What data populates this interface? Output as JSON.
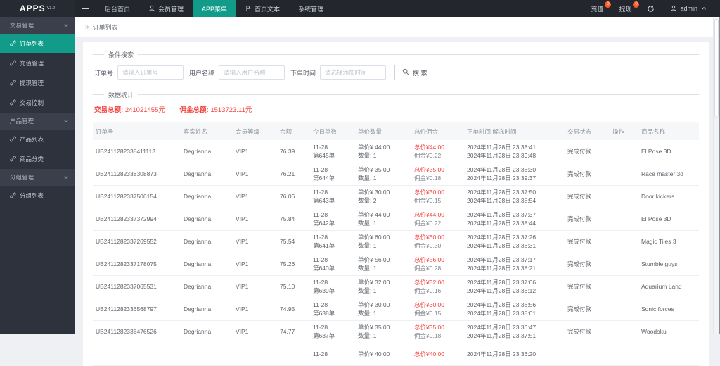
{
  "colors": {
    "accent": "#109C88",
    "red": "#F5413D",
    "badge": "#FF5A22",
    "topbar": "#23262D",
    "sidebar": "#2E323C"
  },
  "topbar": {
    "logo": "APPS",
    "logo_version": "V3.0",
    "nav": [
      {
        "label": "后台首页",
        "icon": "",
        "active": false
      },
      {
        "label": "会员管理",
        "icon": "user",
        "active": false
      },
      {
        "label": "APP菜单",
        "icon": "",
        "active": true
      },
      {
        "label": "首页文本",
        "icon": "flag",
        "active": false
      },
      {
        "label": "系统管理",
        "icon": "",
        "active": false
      }
    ],
    "right": {
      "recharge_label": "充值",
      "recharge_badge": "0",
      "withdraw_label": "提现",
      "withdraw_badge": "0",
      "user_label": "admin"
    }
  },
  "sidebar": {
    "groups": [
      {
        "label": "交易管理",
        "items": [
          {
            "label": "订单列表",
            "active": true
          },
          {
            "label": "充值管理",
            "active": false
          },
          {
            "label": "提现管理",
            "active": false
          },
          {
            "label": "交易控制",
            "active": false
          }
        ]
      },
      {
        "label": "产品管理",
        "items": [
          {
            "label": "产品列表",
            "active": false
          },
          {
            "label": "商品分类",
            "active": false
          }
        ]
      },
      {
        "label": "分组管理",
        "items": [
          {
            "label": "分组列表",
            "active": false
          }
        ]
      }
    ]
  },
  "breadcrumb": {
    "separator": "»",
    "label": "订单列表"
  },
  "search": {
    "section_title": "条件搜索",
    "fields": [
      {
        "label": "订单号",
        "placeholder": "请输入订单号",
        "value": ""
      },
      {
        "label": "用户名称",
        "placeholder": "请输入用户名称",
        "value": ""
      },
      {
        "label": "下单时间",
        "placeholder": "请选择添加时间",
        "value": ""
      }
    ],
    "button_label": "搜 索"
  },
  "stats": {
    "section_title": "数据统计",
    "trade_label": "交易总额:",
    "trade_value": "241021455元",
    "commission_label": "佣金总额:",
    "commission_value": "1513723.11元"
  },
  "table": {
    "columns": [
      "订单号",
      "真实姓名",
      "会员等级",
      "余额",
      "今日单数",
      "单价数量",
      "总价佣金",
      "下单时间 解冻时间",
      "交易状态",
      "操作",
      "商品名称"
    ],
    "rows": [
      {
        "order_no": "UB2411282338411113",
        "name": "Degrianna",
        "level": "VIP1",
        "balance": "76.39",
        "date": "11-28",
        "count": "第645单",
        "price": "单价¥ 44.00",
        "qty": "数量: 1",
        "total": "总价¥44.00",
        "commission": "佣金¥0.22",
        "order_time": "2024年11月28日 23:38:41",
        "unfreeze_time": "2024年11月28日 23:39:48",
        "status": "完成付款",
        "action": "",
        "product": "El Pose 3D"
      },
      {
        "order_no": "UB2411282338308873",
        "name": "Degrianna",
        "level": "VIP1",
        "balance": "76.21",
        "date": "11-28",
        "count": "第644单",
        "price": "单价¥ 35.00",
        "qty": "数量: 1",
        "total": "总价¥35.00",
        "commission": "佣金¥0.18",
        "order_time": "2024年11月28日 23:38:30",
        "unfreeze_time": "2024年11月28日 23:39:37",
        "status": "完成付款",
        "action": "",
        "product": "Race master 3d"
      },
      {
        "order_no": "UB2411282337506154",
        "name": "Degrianna",
        "level": "VIP1",
        "balance": "76.06",
        "date": "11-28",
        "count": "第643单",
        "price": "单价¥ 30.00",
        "qty": "数量: 2",
        "total": "总价¥30.00",
        "commission": "佣金¥0.15",
        "order_time": "2024年11月28日 23:37:50",
        "unfreeze_time": "2024年11月28日 23:38:54",
        "status": "完成付款",
        "action": "",
        "product": "Door kickers"
      },
      {
        "order_no": "UB2411282337372994",
        "name": "Degrianna",
        "level": "VIP1",
        "balance": "75.84",
        "date": "11-28",
        "count": "第642单",
        "price": "单价¥ 44.00",
        "qty": "数量: 1",
        "total": "总价¥44.00",
        "commission": "佣金¥0.22",
        "order_time": "2024年11月28日 23:37:37",
        "unfreeze_time": "2024年11月28日 23:38:44",
        "status": "完成付款",
        "action": "",
        "product": "El Pose 3D"
      },
      {
        "order_no": "UB2411282337269552",
        "name": "Degrianna",
        "level": "VIP1",
        "balance": "75.54",
        "date": "11-28",
        "count": "第641单",
        "price": "单价¥ 60.00",
        "qty": "数量: 1",
        "total": "总价¥60.00",
        "commission": "佣金¥0.30",
        "order_time": "2024年11月28日 23:37:26",
        "unfreeze_time": "2024年11月28日 23:38:31",
        "status": "完成付款",
        "action": "",
        "product": "Magic Tiles 3"
      },
      {
        "order_no": "UB2411282337178075",
        "name": "Degrianna",
        "level": "VIP1",
        "balance": "75.26",
        "date": "11-28",
        "count": "第640单",
        "price": "单价¥ 56.00",
        "qty": "数量: 1",
        "total": "总价¥56.00",
        "commission": "佣金¥0.28",
        "order_time": "2024年11月28日 23:37:17",
        "unfreeze_time": "2024年11月28日 23:38:21",
        "status": "完成付款",
        "action": "",
        "product": "Stumble guys"
      },
      {
        "order_no": "UB2411282337065531",
        "name": "Degrianna",
        "level": "VIP1",
        "balance": "75.10",
        "date": "11-28",
        "count": "第639单",
        "price": "单价¥ 32.00",
        "qty": "数量: 1",
        "total": "总价¥32.00",
        "commission": "佣金¥0.16",
        "order_time": "2024年11月28日 23:37:06",
        "unfreeze_time": "2024年11月28日 23:38:12",
        "status": "完成付款",
        "action": "",
        "product": "Aquarium Land"
      },
      {
        "order_no": "UB2411282336568797",
        "name": "Degrianna",
        "level": "VIP1",
        "balance": "74.95",
        "date": "11-28",
        "count": "第638单",
        "price": "单价¥ 30.00",
        "qty": "数量: 1",
        "total": "总价¥30.00",
        "commission": "佣金¥0.15",
        "order_time": "2024年11月28日 23:36:56",
        "unfreeze_time": "2024年11月28日 23:38:01",
        "status": "完成付款",
        "action": "",
        "product": "Sonic forces"
      },
      {
        "order_no": "UB2411282336476526",
        "name": "Degrianna",
        "level": "VIP1",
        "balance": "74.77",
        "date": "11-28",
        "count": "第637单",
        "price": "单价¥ 35.00",
        "qty": "数量: 1",
        "total": "总价¥35.00",
        "commission": "佣金¥0.18",
        "order_time": "2024年11月28日 23:36:47",
        "unfreeze_time": "2024年11月28日 23:37:51",
        "status": "完成付款",
        "action": "",
        "product": "Woodoku"
      },
      {
        "order_no": "",
        "name": "",
        "level": "",
        "balance": "",
        "date": "11-28",
        "count": "",
        "price": "单价¥ 40.00",
        "qty": "",
        "total": "总价¥40.00",
        "commission": "",
        "order_time": "2024年11月28日 23:36:20",
        "unfreeze_time": "",
        "status": "",
        "action": "",
        "product": ""
      }
    ]
  }
}
